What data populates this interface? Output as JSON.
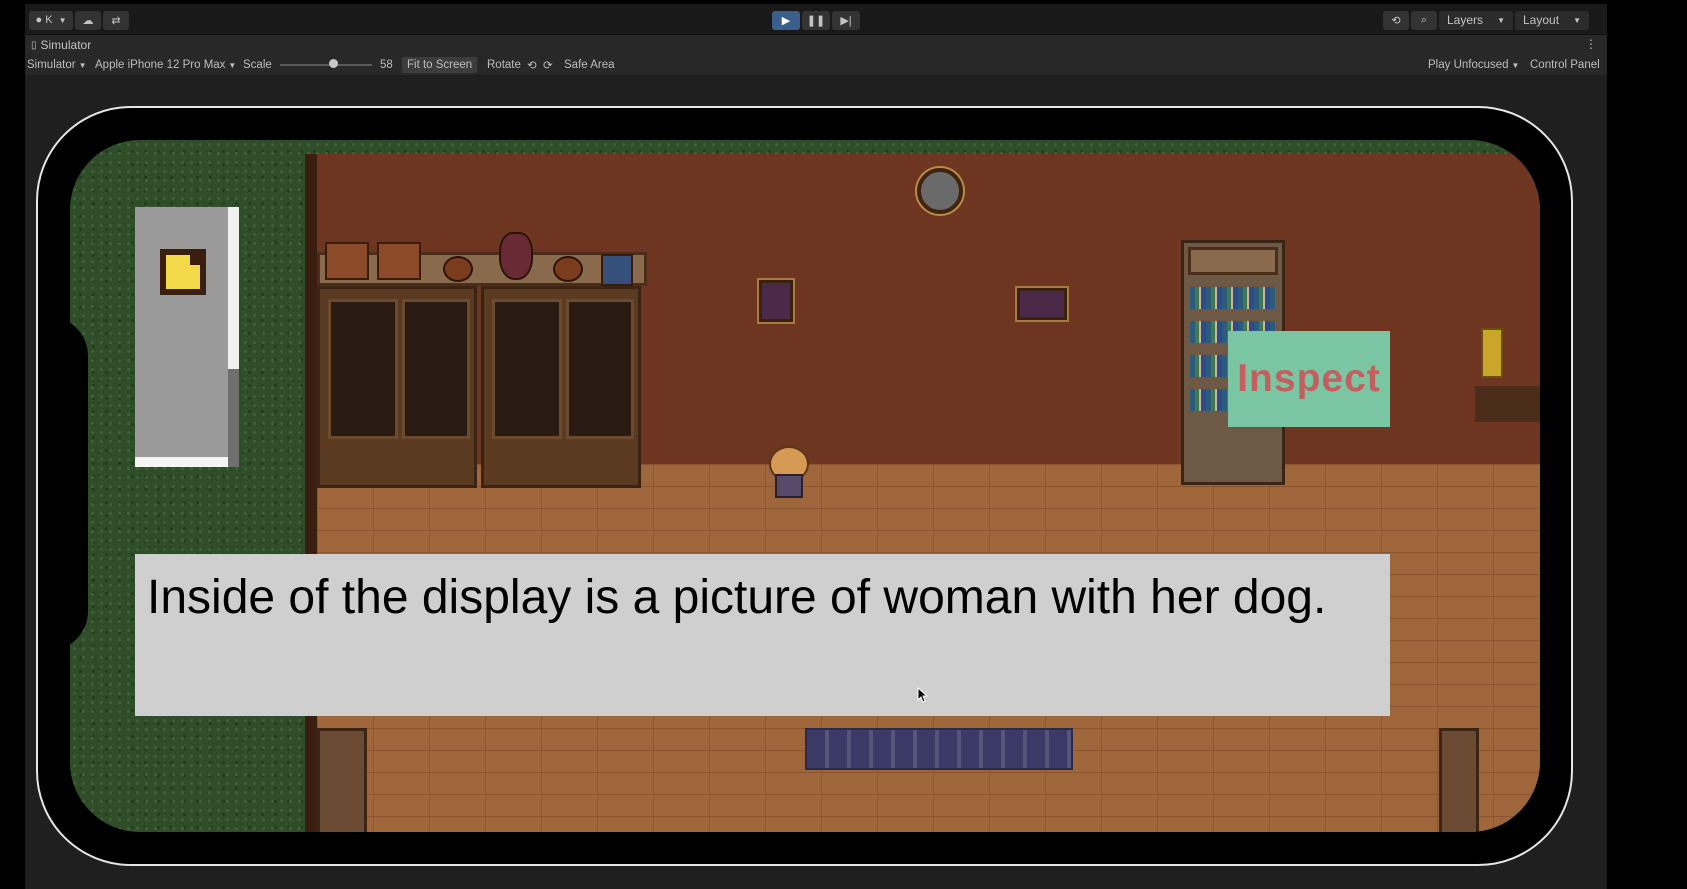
{
  "toolbar": {
    "account_label": "K",
    "play_icon": "play-icon",
    "pause_icon": "pause-icon",
    "step_icon": "step-icon",
    "layers_label": "Layers",
    "layout_label": "Layout"
  },
  "tab": {
    "title": "Simulator"
  },
  "simulator_bar": {
    "mode_label": "Simulator",
    "device_label": "Apple iPhone 12 Pro Max",
    "scale_label": "Scale",
    "scale_value": "58",
    "scale_fraction": 0.58,
    "fit_label": "Fit to Screen",
    "rotate_label": "Rotate",
    "safe_area_label": "Safe Area",
    "play_focus_label": "Play Unfocused",
    "control_panel_label": "Control Panel"
  },
  "game": {
    "inspect_label": "Inspect",
    "dialog_text": "Inside of the display is a picture of woman with her dog."
  },
  "colors": {
    "accent": "#3a5f8c",
    "inspect_bg": "#7bc6a2",
    "inspect_text": "#c55f5f",
    "dialog_bg": "#cfcfcf",
    "hud_icon": "#f4d94a"
  }
}
